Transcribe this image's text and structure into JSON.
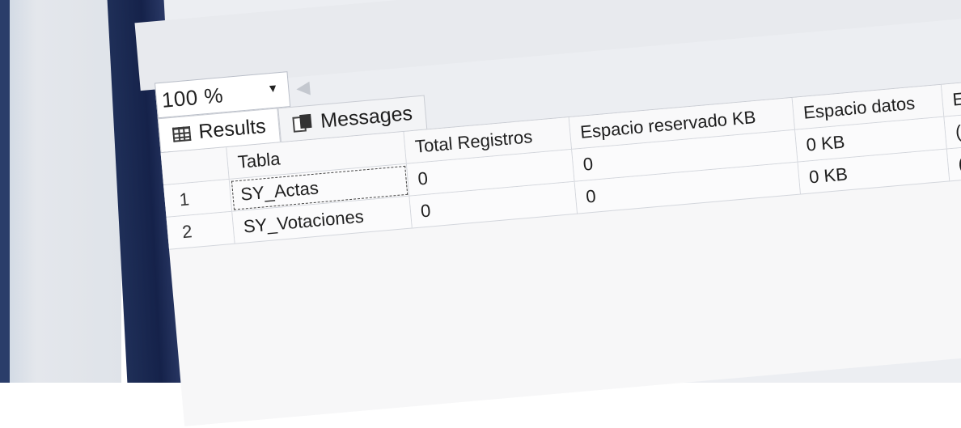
{
  "zoom": {
    "value": "100 %",
    "arrow": "▼"
  },
  "tabs": [
    {
      "label": "Results"
    },
    {
      "label": "Messages"
    }
  ],
  "grid": {
    "columns": [
      "",
      "Tabla",
      "Total Registros",
      "Espacio reservado KB",
      "Espacio datos",
      "E"
    ],
    "rows": [
      {
        "num": "1",
        "tabla": "SY_Actas",
        "total": "0",
        "reservado": "0",
        "datos": "0 KB",
        "extra": "("
      },
      {
        "num": "2",
        "tabla": "SY_Votaciones",
        "total": "0",
        "reservado": "0",
        "datos": "0 KB",
        "extra": "("
      }
    ]
  }
}
